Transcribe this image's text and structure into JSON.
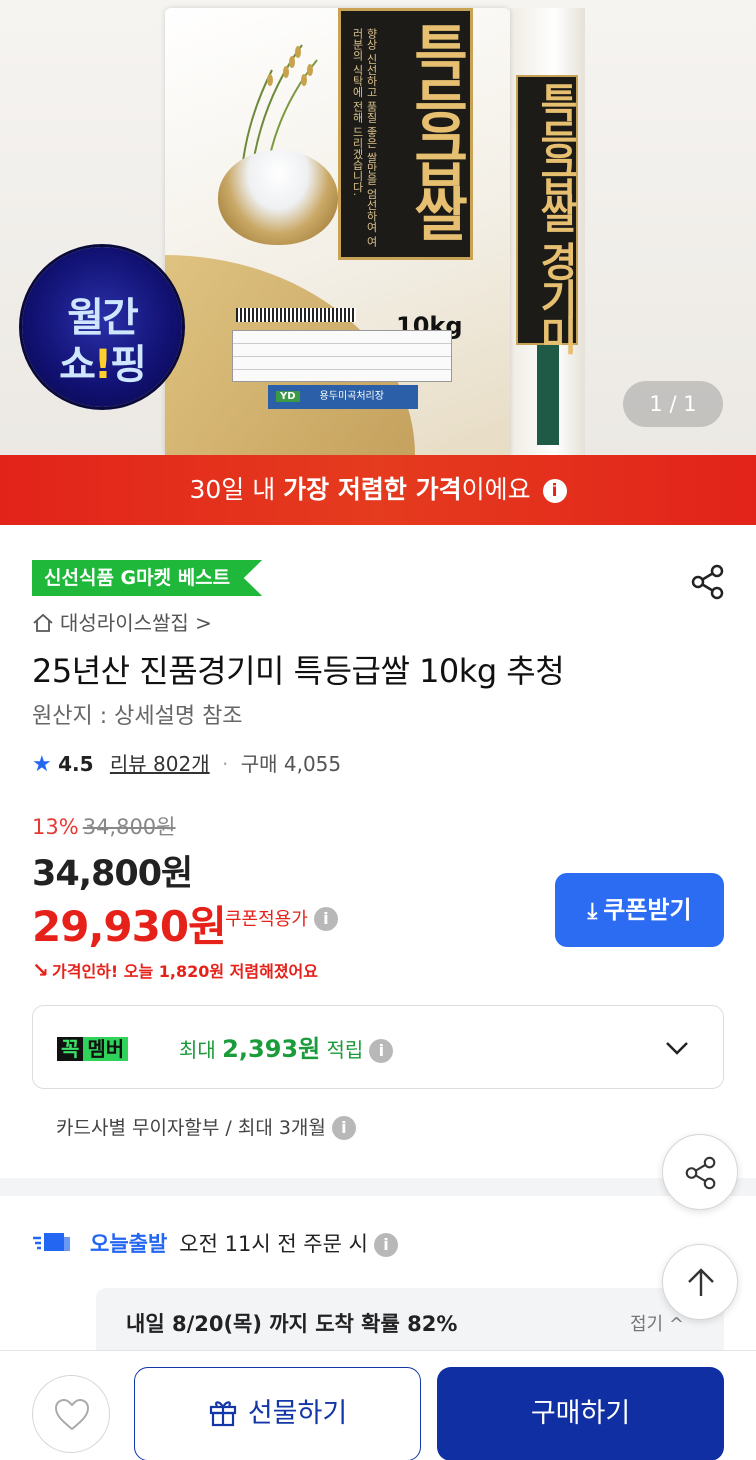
{
  "hero": {
    "bag_title": "특등급쌀",
    "bag_subtitle": "향상 신선하고 품질 좋은 쌀만을 엄선하여 여러분의 식탁에 전해 드리겠습니다.",
    "bag_side_title": "특등급쌀 경기미",
    "bag_weight": "10kg",
    "bag_maker_logo": "YD",
    "bag_maker": "용두미곡처리장",
    "badge_line1": "월간",
    "badge_line2_a": "쇼",
    "badge_line2_b": "!",
    "badge_line2_c": "핑",
    "pager": "1 / 1"
  },
  "banner": {
    "prefix": "30일 내 ",
    "bold": "가장 저렴한 가격",
    "suffix": "이에요",
    "info": "i"
  },
  "product": {
    "best_tag": "신선식품 G마켓 베스트",
    "store": "대성라이스쌀집 >",
    "title": "25년산 진품경기미 특등급쌀 10kg 추청",
    "origin": "원산지 : 상세설명 참조",
    "rating_icon": "★",
    "rating": "4.5",
    "reviews": "리뷰 802개",
    "separator": "·",
    "purchases": "구매 4,055"
  },
  "price": {
    "discount_pct": "13%",
    "original": "34,800원",
    "base": "34,800원",
    "coupon_price": "29,930원",
    "coupon_note": "쿠폰적용가",
    "info": "i",
    "coupon_button": "쿠폰받기",
    "coupon_button_icon": "⤓",
    "drop_icon": "↘",
    "drop_note": "가격인하! 오늘 1,820원 저렴해졌어요"
  },
  "membership": {
    "tag_a": "꼭",
    "tag_b": "멤버",
    "text_prefix": "최대 ",
    "amount": "2,393원",
    "text_suffix": " 적립",
    "info": "i"
  },
  "installment": {
    "text": "카드사별 무이자할부 / 최대 3개월",
    "info": "i"
  },
  "shipping": {
    "today": "오늘출발",
    "condition": "오전 11시 전 주문 시",
    "info": "i",
    "arrival": "내일 8/20(목) 까지 도착 확률 82%",
    "fold": "접기 ^"
  },
  "bottom_bar": {
    "gift": "선물하기",
    "buy": "구매하기"
  },
  "colors": {
    "banner_red": "#e2231a",
    "price_red": "#e5211a",
    "coupon_blue": "#2b6cf3",
    "buy_navy": "#0f2fa3",
    "member_green": "#1b9c3a",
    "best_green": "#1fb83a"
  },
  "icons": [
    "share-icon",
    "home-icon",
    "star-icon",
    "info-icon",
    "download-icon",
    "price-drop-icon",
    "chevron-down-icon",
    "truck-icon",
    "arrow-up-icon",
    "heart-icon",
    "gift-icon"
  ]
}
